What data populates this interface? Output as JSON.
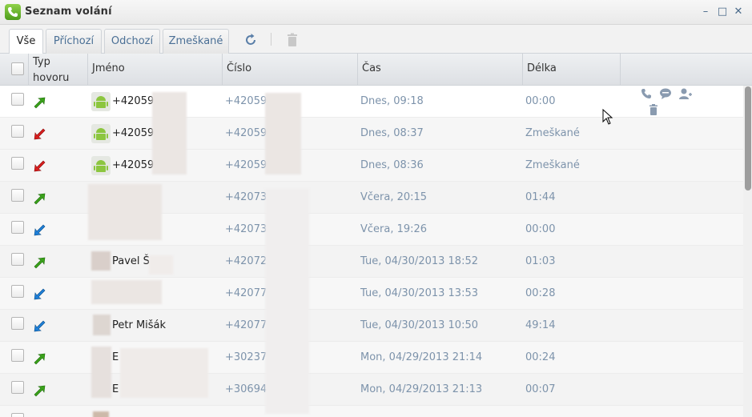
{
  "window": {
    "title": "Seznam volání"
  },
  "tabs": [
    {
      "label": "Vše",
      "active": true
    },
    {
      "label": "Příchozí",
      "active": false
    },
    {
      "label": "Odchozí",
      "active": false
    },
    {
      "label": "Zmeškané",
      "active": false
    }
  ],
  "toolbar": {
    "refresh_icon": "refresh-icon",
    "delete_icon": "trash-icon"
  },
  "columns": {
    "type": "Typ hovoru",
    "name": "Jméno",
    "number": "Číslo",
    "time": "Čas",
    "duration": "Délka"
  },
  "colors": {
    "outgoing": "#3aa21a",
    "missed": "#d81e1e",
    "incoming": "#1e7fd8",
    "link": "#7d93ab"
  },
  "rows": [
    {
      "type": "outgoing",
      "name": "+420596",
      "number": "+420596",
      "time": "Dnes, 09:18",
      "duration": "00:00",
      "avatar": "android"
    },
    {
      "type": "missed",
      "name": "+420596",
      "number": "+420596",
      "time": "Dnes, 08:37",
      "duration": "Zmeškané",
      "avatar": "android"
    },
    {
      "type": "missed",
      "name": "+420596",
      "number": "+420596",
      "time": "Dnes, 08:36",
      "duration": "Zmeškané",
      "avatar": "android"
    },
    {
      "type": "outgoing",
      "name": "",
      "number": "+420737",
      "time": "Včera, 20:15",
      "duration": "01:44",
      "avatar": ""
    },
    {
      "type": "incoming",
      "name": "",
      "number": "+420737",
      "time": "Včera, 19:26",
      "duration": "00:00",
      "avatar": ""
    },
    {
      "type": "outgoing",
      "name": "Pavel Š",
      "number": "+420720",
      "time": "Tue, 04/30/2013 18:52",
      "duration": "01:03",
      "avatar": "photo"
    },
    {
      "type": "incoming",
      "name": "",
      "number": "+420777",
      "time": "Tue, 04/30/2013 13:53",
      "duration": "00:28",
      "avatar": ""
    },
    {
      "type": "incoming",
      "name": "Petr Mišák",
      "number": "+420777",
      "time": "Tue, 04/30/2013 10:50",
      "duration": "49:14",
      "avatar": "photo"
    },
    {
      "type": "outgoing",
      "name": "E",
      "number": "+302374",
      "time": "Mon, 04/29/2013 21:14",
      "duration": "00:24",
      "avatar": "photo"
    },
    {
      "type": "outgoing",
      "name": "E",
      "number": "+306946",
      "time": "Mon, 04/29/2013 21:13",
      "duration": "00:07",
      "avatar": "photo"
    }
  ],
  "row_actions": [
    "phone-icon",
    "chat-icon",
    "add-contact-icon",
    "trash-icon"
  ]
}
